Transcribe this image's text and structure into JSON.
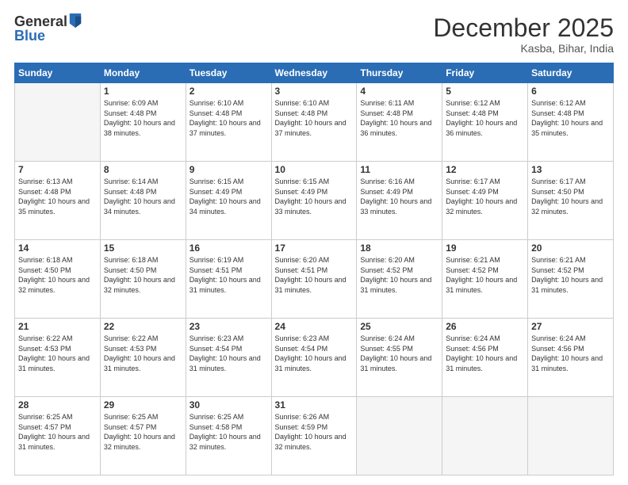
{
  "header": {
    "logo_general": "General",
    "logo_blue": "Blue",
    "month_title": "December 2025",
    "subtitle": "Kasba, Bihar, India"
  },
  "days_of_week": [
    "Sunday",
    "Monday",
    "Tuesday",
    "Wednesday",
    "Thursday",
    "Friday",
    "Saturday"
  ],
  "weeks": [
    [
      {
        "day": "",
        "sunrise": "",
        "sunset": "",
        "daylight": "",
        "empty": true
      },
      {
        "day": "1",
        "sunrise": "6:09 AM",
        "sunset": "4:48 PM",
        "daylight": "10 hours and 38 minutes."
      },
      {
        "day": "2",
        "sunrise": "6:10 AM",
        "sunset": "4:48 PM",
        "daylight": "10 hours and 37 minutes."
      },
      {
        "day": "3",
        "sunrise": "6:10 AM",
        "sunset": "4:48 PM",
        "daylight": "10 hours and 37 minutes."
      },
      {
        "day": "4",
        "sunrise": "6:11 AM",
        "sunset": "4:48 PM",
        "daylight": "10 hours and 36 minutes."
      },
      {
        "day": "5",
        "sunrise": "6:12 AM",
        "sunset": "4:48 PM",
        "daylight": "10 hours and 36 minutes."
      },
      {
        "day": "6",
        "sunrise": "6:12 AM",
        "sunset": "4:48 PM",
        "daylight": "10 hours and 35 minutes."
      }
    ],
    [
      {
        "day": "7",
        "sunrise": "6:13 AM",
        "sunset": "4:48 PM",
        "daylight": "10 hours and 35 minutes."
      },
      {
        "day": "8",
        "sunrise": "6:14 AM",
        "sunset": "4:48 PM",
        "daylight": "10 hours and 34 minutes."
      },
      {
        "day": "9",
        "sunrise": "6:15 AM",
        "sunset": "4:49 PM",
        "daylight": "10 hours and 34 minutes."
      },
      {
        "day": "10",
        "sunrise": "6:15 AM",
        "sunset": "4:49 PM",
        "daylight": "10 hours and 33 minutes."
      },
      {
        "day": "11",
        "sunrise": "6:16 AM",
        "sunset": "4:49 PM",
        "daylight": "10 hours and 33 minutes."
      },
      {
        "day": "12",
        "sunrise": "6:17 AM",
        "sunset": "4:49 PM",
        "daylight": "10 hours and 32 minutes."
      },
      {
        "day": "13",
        "sunrise": "6:17 AM",
        "sunset": "4:50 PM",
        "daylight": "10 hours and 32 minutes."
      }
    ],
    [
      {
        "day": "14",
        "sunrise": "6:18 AM",
        "sunset": "4:50 PM",
        "daylight": "10 hours and 32 minutes."
      },
      {
        "day": "15",
        "sunrise": "6:18 AM",
        "sunset": "4:50 PM",
        "daylight": "10 hours and 32 minutes."
      },
      {
        "day": "16",
        "sunrise": "6:19 AM",
        "sunset": "4:51 PM",
        "daylight": "10 hours and 31 minutes."
      },
      {
        "day": "17",
        "sunrise": "6:20 AM",
        "sunset": "4:51 PM",
        "daylight": "10 hours and 31 minutes."
      },
      {
        "day": "18",
        "sunrise": "6:20 AM",
        "sunset": "4:52 PM",
        "daylight": "10 hours and 31 minutes."
      },
      {
        "day": "19",
        "sunrise": "6:21 AM",
        "sunset": "4:52 PM",
        "daylight": "10 hours and 31 minutes."
      },
      {
        "day": "20",
        "sunrise": "6:21 AM",
        "sunset": "4:52 PM",
        "daylight": "10 hours and 31 minutes."
      }
    ],
    [
      {
        "day": "21",
        "sunrise": "6:22 AM",
        "sunset": "4:53 PM",
        "daylight": "10 hours and 31 minutes."
      },
      {
        "day": "22",
        "sunrise": "6:22 AM",
        "sunset": "4:53 PM",
        "daylight": "10 hours and 31 minutes."
      },
      {
        "day": "23",
        "sunrise": "6:23 AM",
        "sunset": "4:54 PM",
        "daylight": "10 hours and 31 minutes."
      },
      {
        "day": "24",
        "sunrise": "6:23 AM",
        "sunset": "4:54 PM",
        "daylight": "10 hours and 31 minutes."
      },
      {
        "day": "25",
        "sunrise": "6:24 AM",
        "sunset": "4:55 PM",
        "daylight": "10 hours and 31 minutes."
      },
      {
        "day": "26",
        "sunrise": "6:24 AM",
        "sunset": "4:56 PM",
        "daylight": "10 hours and 31 minutes."
      },
      {
        "day": "27",
        "sunrise": "6:24 AM",
        "sunset": "4:56 PM",
        "daylight": "10 hours and 31 minutes."
      }
    ],
    [
      {
        "day": "28",
        "sunrise": "6:25 AM",
        "sunset": "4:57 PM",
        "daylight": "10 hours and 31 minutes."
      },
      {
        "day": "29",
        "sunrise": "6:25 AM",
        "sunset": "4:57 PM",
        "daylight": "10 hours and 32 minutes."
      },
      {
        "day": "30",
        "sunrise": "6:25 AM",
        "sunset": "4:58 PM",
        "daylight": "10 hours and 32 minutes."
      },
      {
        "day": "31",
        "sunrise": "6:26 AM",
        "sunset": "4:59 PM",
        "daylight": "10 hours and 32 minutes."
      },
      {
        "day": "",
        "sunrise": "",
        "sunset": "",
        "daylight": "",
        "empty": true
      },
      {
        "day": "",
        "sunrise": "",
        "sunset": "",
        "daylight": "",
        "empty": true
      },
      {
        "day": "",
        "sunrise": "",
        "sunset": "",
        "daylight": "",
        "empty": true
      }
    ]
  ]
}
